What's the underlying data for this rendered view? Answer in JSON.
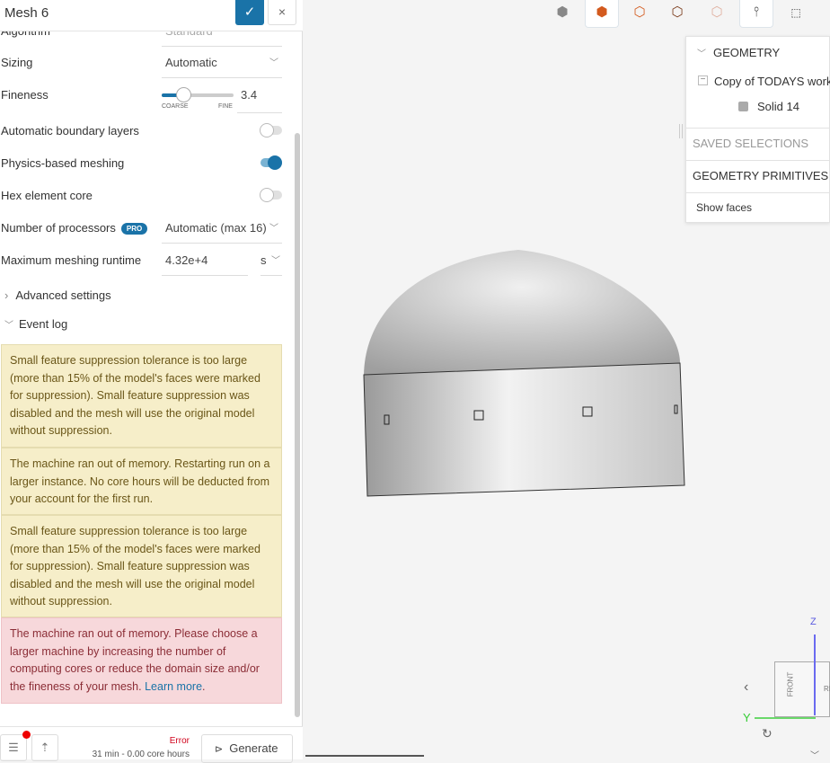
{
  "header": {
    "title": "Mesh 6",
    "confirm_icon": "✓",
    "close_icon": "×"
  },
  "settings": {
    "algorithm": {
      "label": "Algorithm",
      "value": "Standard"
    },
    "sizing": {
      "label": "Sizing",
      "value": "Automatic"
    },
    "fineness": {
      "label": "Fineness",
      "value": "3.4",
      "min_label": "COARSE",
      "max_label": "FINE",
      "level_fraction": 0.3
    },
    "boundary_layers": {
      "label": "Automatic boundary layers",
      "on": false
    },
    "physics_based": {
      "label": "Physics-based meshing",
      "on": true
    },
    "hex_core": {
      "label": "Hex element core",
      "on": false
    },
    "processors": {
      "label": "Number of processors",
      "badge": "PRO",
      "value": "Automatic (max 16)"
    },
    "runtime": {
      "label": "Maximum meshing runtime",
      "value": "4.32e+4",
      "unit": "s"
    }
  },
  "sections": {
    "advanced": "Advanced settings",
    "event_log": "Event log"
  },
  "event_log": [
    {
      "type": "warning",
      "text": "Small feature suppression tolerance is too large (more than 15% of the model's faces were marked for suppression). Small feature suppression was disabled and the mesh will use the original model without suppression."
    },
    {
      "type": "warning",
      "text": "The machine ran out of memory. Restarting run on a larger instance. No core hours will be deducted from your account for the first run."
    },
    {
      "type": "warning",
      "text": "Small feature suppression tolerance is too large (more than 15% of the model's faces were marked for suppression). Small feature suppression was disabled and the mesh will use the original model without suppression."
    },
    {
      "type": "error",
      "text": "The machine ran out of memory. Please choose a larger machine by increasing the number of computing cores or reduce the domain size and/or the fineness of your mesh. ",
      "link": "Learn more",
      "suffix": "."
    }
  ],
  "footer": {
    "status": "Error",
    "runtime": "31 min - 0.00 core hours",
    "generate": "Generate"
  },
  "tree": {
    "geometry": "GEOMETRY",
    "root": "Copy of TODAYS work",
    "solid": "Solid 14",
    "saved": "SAVED SELECTIONS",
    "primitives": "GEOMETRY PRIMITIVES",
    "show_faces": "Show faces"
  },
  "orientation": {
    "front": "FRONT",
    "right": "RI",
    "z": "Z",
    "y": "Y"
  },
  "colors": {
    "accent": "#1a73a8",
    "error": "#d0021b",
    "warning_bg": "#f6eec9",
    "error_bg": "#f7d8db"
  }
}
